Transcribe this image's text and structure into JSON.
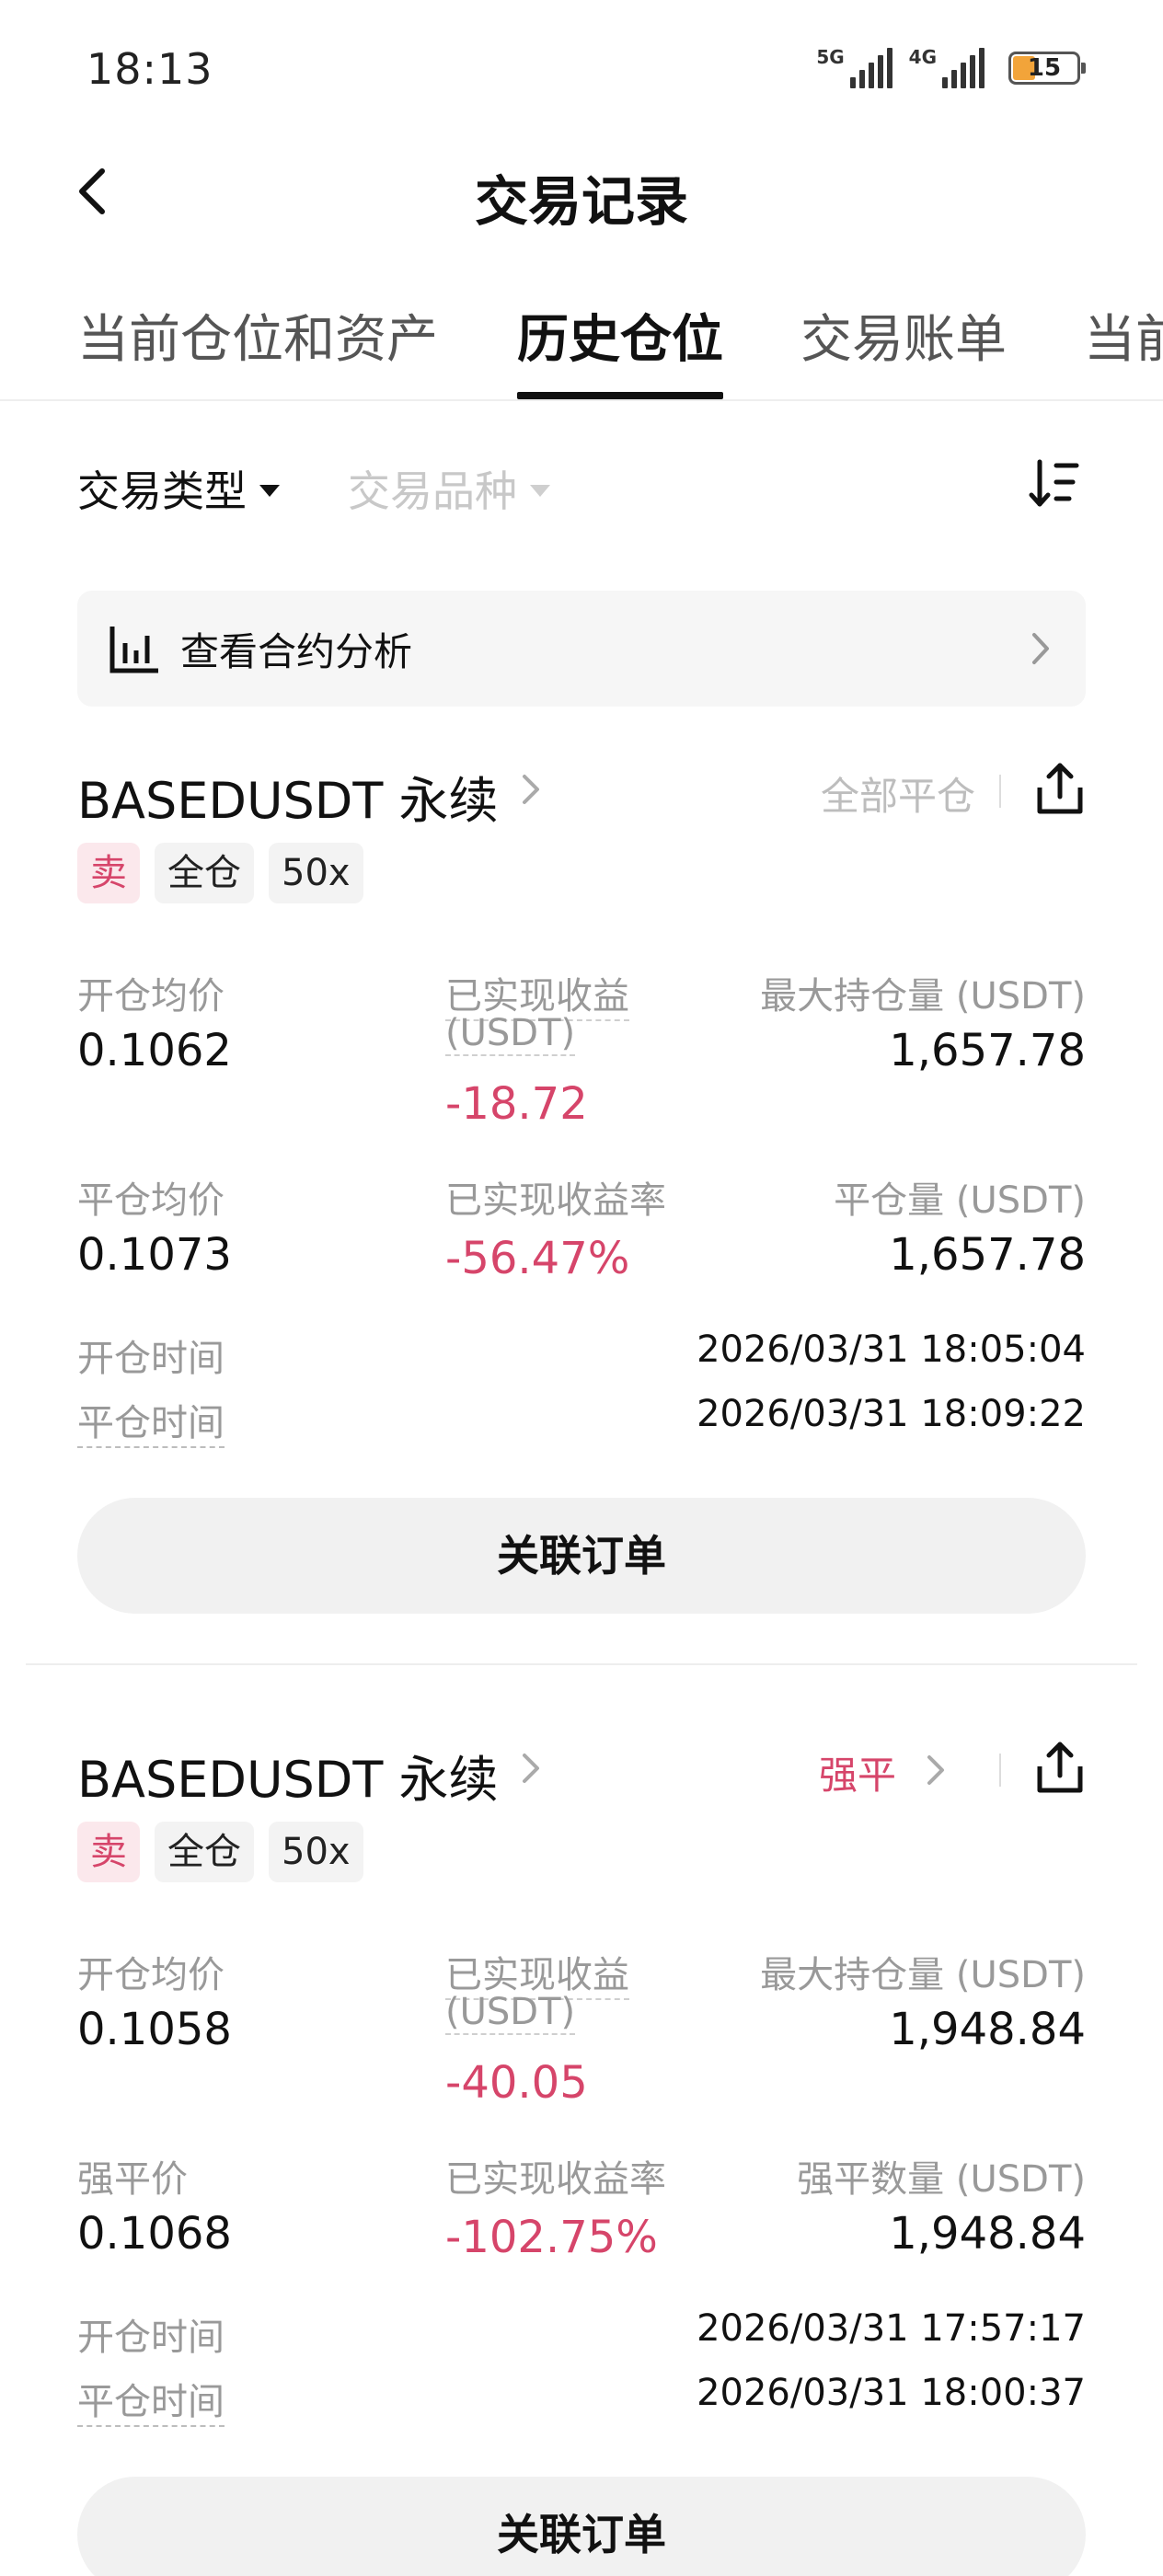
{
  "status_bar": {
    "time": "18:13",
    "network1": "5G",
    "network2": "4G",
    "battery": "15"
  },
  "header": {
    "title": "交易记录",
    "back_icon": "chevron-left-icon"
  },
  "tabs": [
    {
      "label": "当前仓位和资产",
      "active": false
    },
    {
      "label": "历史仓位",
      "active": true
    },
    {
      "label": "交易账单",
      "active": false
    },
    {
      "label": "当前",
      "active": false
    }
  ],
  "filters": {
    "trade_type": "交易类型",
    "instrument": "交易品种",
    "sort_icon": "sort-icon"
  },
  "analysis": {
    "label": "查看合约分析",
    "icon": "bar-chart-icon"
  },
  "positions": [
    {
      "symbol": "BASEDUSDT 永续",
      "close_type": "全部平仓",
      "tags": [
        "卖",
        "全仓",
        "50x"
      ],
      "open_avg_label": "开仓均价",
      "open_avg": "0.1062",
      "pnl_label_1": "已实现收益",
      "pnl_label_2": "(USDT)",
      "pnl": "-18.72",
      "max_pos_label": "最大持仓量 (USDT)",
      "max_pos": "1,657.78",
      "close_avg_label": "平仓均价",
      "close_avg": "0.1073",
      "pnl_rate_label": "已实现收益率",
      "pnl_rate": "-56.47%",
      "close_amt_label": "平仓量 (USDT)",
      "close_amt": "1,657.78",
      "open_time_label": "开仓时间",
      "open_time": "2026/03/31 18:05:04",
      "close_time_label": "平仓时间",
      "close_time": "2026/03/31 18:09:22",
      "orders_button": "关联订单"
    },
    {
      "symbol": "BASEDUSDT 永续",
      "close_type": "强平",
      "tags": [
        "卖",
        "全仓",
        "50x"
      ],
      "open_avg_label": "开仓均价",
      "open_avg": "0.1058",
      "pnl_label_1": "已实现收益",
      "pnl_label_2": "(USDT)",
      "pnl": "-40.05",
      "max_pos_label": "最大持仓量 (USDT)",
      "max_pos": "1,948.84",
      "close_avg_label": "强平价",
      "close_avg": "0.1068",
      "pnl_rate_label": "已实现收益率",
      "pnl_rate": "-102.75%",
      "close_amt_label": "强平数量 (USDT)",
      "close_amt": "1,948.84",
      "open_time_label": "开仓时间",
      "open_time": "2026/03/31 17:57:17",
      "close_time_label": "平仓时间",
      "close_time": "2026/03/31 18:00:37",
      "orders_button": "关联订单"
    }
  ],
  "colors": {
    "loss": "#d6456a",
    "muted": "#999999",
    "text": "#111111"
  }
}
